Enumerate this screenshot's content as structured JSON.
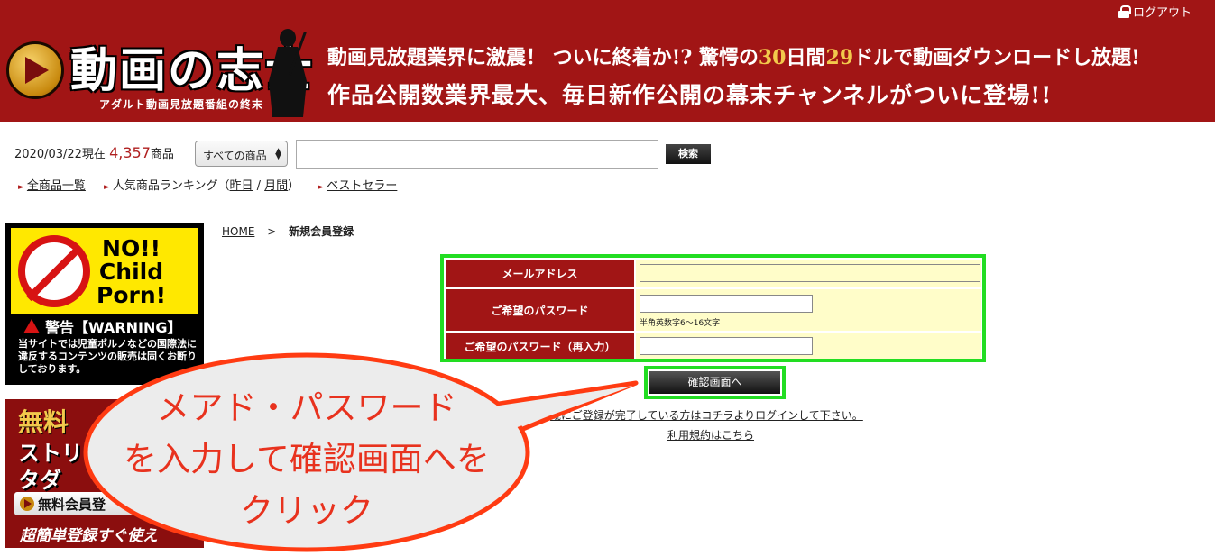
{
  "header": {
    "logout_label": "ログアウト",
    "logo_text": "動画の志士",
    "logo_subtitle": "アダルト動画見放題番組の終末",
    "banner_line1_a": "動画見放題業界に激震！ ついに終着か!? 驚愕の",
    "banner_line1_hl1": "30",
    "banner_line1_b": "日間",
    "banner_line1_hl2": "29",
    "banner_line1_c": "ドルで動画ダウンロードし放題!",
    "banner_line2": "作品公開数業界最大、毎日新作公開の幕末チャンネルがついに登場!!"
  },
  "search": {
    "date_prefix": "2020/03/22現在",
    "count": "4,357",
    "count_suffix": "商品",
    "category_selected": "すべての商品",
    "button_label": "検索"
  },
  "quicklinks": {
    "all_products": "全商品一覧",
    "ranking_prefix": "人気商品ランキング（",
    "ranking_daily": "昨日",
    "ranking_sep": " / ",
    "ranking_monthly": "月間",
    "ranking_suffix": "）",
    "bestseller": "ベストセラー"
  },
  "sidebar": {
    "nocp_line1": "NO!!",
    "nocp_line2": "Child",
    "nocp_line3": "Porn!",
    "warning_title": "警告【WARNING】",
    "warning_text": "当サイトでは児童ポルノなどの国際法に違反するコンテンツの販売は固くお断りしております。",
    "free_title": "無料",
    "free_line2": "ストリー",
    "free_line3": "タダ",
    "free_button": "無料会員登",
    "free_line4": "超簡単登録すぐ使え"
  },
  "breadcrumb": {
    "home": "HOME",
    "sep": ">",
    "current": "新規会員登録"
  },
  "form": {
    "email_label": "メールアドレス",
    "password_label": "ご希望のパスワード",
    "password_hint": "半角英数字6〜16文字",
    "password_confirm_label": "ご希望のパスワード（再入力）",
    "submit_label": "確認画面へ",
    "login_link": "既にご登録が完了している方はコチラよりログインして下さい。",
    "terms_link": "利用規約はこちら"
  },
  "callout": {
    "line1": "メアド・パスワード",
    "line2": "を入力して確認画面へを",
    "line3": "クリック"
  },
  "colors": {
    "header_bg": "#a11515",
    "highlight_border": "#22dd22",
    "callout_text": "#e8321e",
    "callout_border": "#ff3b12"
  }
}
